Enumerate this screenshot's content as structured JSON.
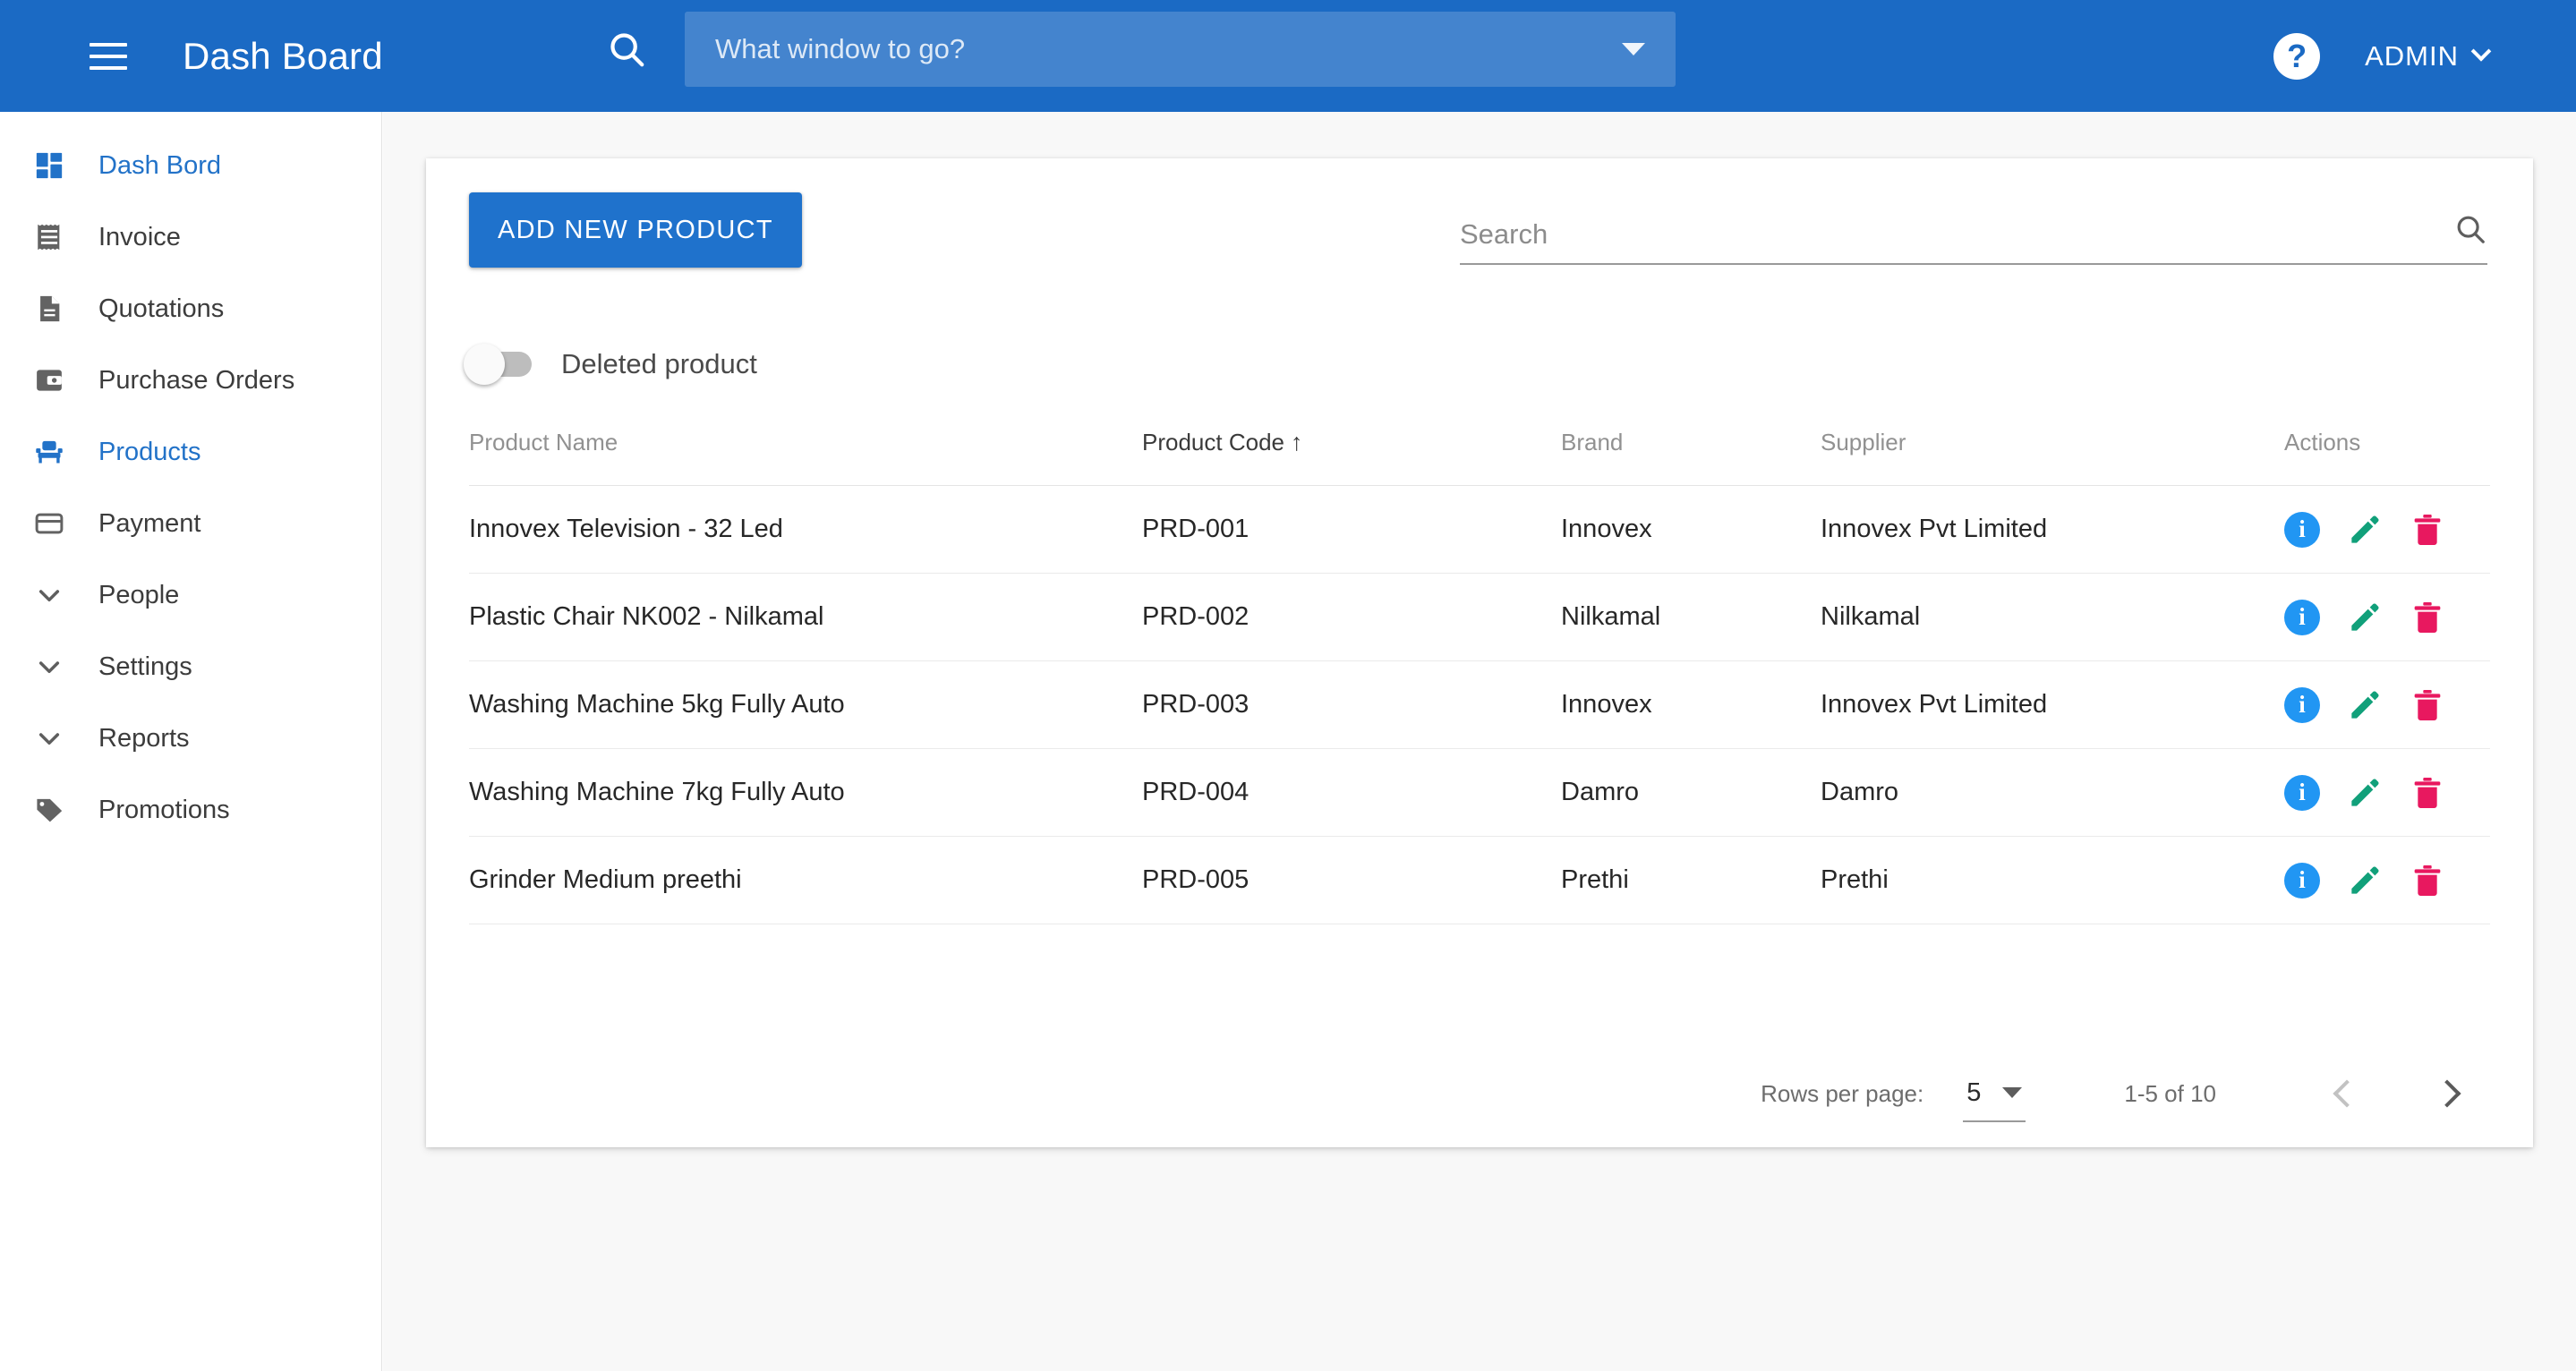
{
  "appbar": {
    "menu_icon": "hamburger-menu-icon",
    "title": "Dash Board",
    "search_icon": "search-icon",
    "search_placeholder": "What window to go?",
    "dropdown_icon": "caret-down-icon",
    "help_icon": "help-question-icon",
    "help_label": "?",
    "admin_label": "ADMIN",
    "admin_chevron": "chevron-down-icon",
    "bg_color": "#1b6ac4"
  },
  "sidebar": {
    "items": [
      {
        "label": "Dash Bord",
        "icon": "dashboard-grid-icon",
        "active": true
      },
      {
        "label": "Invoice",
        "icon": "invoice-receipt-icon",
        "active": false
      },
      {
        "label": "Quotations",
        "icon": "document-icon",
        "active": false
      },
      {
        "label": "Purchase Orders",
        "icon": "wallet-icon",
        "active": false
      },
      {
        "label": "Products",
        "icon": "armchair-icon",
        "active": true
      },
      {
        "label": "Payment",
        "icon": "credit-card-icon",
        "active": false
      },
      {
        "label": "People",
        "icon": "chevron-down-icon",
        "active": false
      },
      {
        "label": "Settings",
        "icon": "chevron-down-icon",
        "active": false
      },
      {
        "label": "Reports",
        "icon": "chevron-down-icon",
        "active": false
      },
      {
        "label": "Promotions",
        "icon": "tag-icon",
        "active": false
      }
    ],
    "active_color": "#2272c8"
  },
  "toolbar": {
    "add_button_label": "ADD NEW PRODUCT",
    "add_button_color": "#1f72cc",
    "search_placeholder": "Search",
    "search_icon": "search-icon"
  },
  "filters": {
    "deleted_toggle_label": "Deleted product",
    "deleted_toggle_on": false
  },
  "table": {
    "columns": [
      {
        "label": "Product Name",
        "sorted": false
      },
      {
        "label": "Product Code",
        "sorted": true,
        "sort_dir": "↑"
      },
      {
        "label": "Brand",
        "sorted": false
      },
      {
        "label": "Supplier",
        "sorted": false
      },
      {
        "label": "Actions",
        "sorted": false
      }
    ],
    "rows": [
      {
        "name": "Innovex Television - 32 Led",
        "code": "PRD-001",
        "brand": "Innovex",
        "supplier": "Innovex Pvt Limited"
      },
      {
        "name": "Plastic Chair NK002 - Nilkamal",
        "code": "PRD-002",
        "brand": "Nilkamal",
        "supplier": "Nilkamal"
      },
      {
        "name": "Washing Machine 5kg Fully Auto",
        "code": "PRD-003",
        "brand": "Innovex",
        "supplier": "Innovex Pvt Limited"
      },
      {
        "name": "Washing Machine 7kg Fully Auto",
        "code": "PRD-004",
        "brand": "Damro",
        "supplier": "Damro"
      },
      {
        "name": "Grinder Medium preethi",
        "code": "PRD-005",
        "brand": "Prethi",
        "supplier": "Prethi"
      }
    ],
    "action_icons": {
      "info": "info-circle-icon",
      "edit": "pencil-edit-icon",
      "delete": "trash-delete-icon",
      "info_color": "#2196f3",
      "edit_color": "#11a07a",
      "delete_color": "#e8185f"
    }
  },
  "pagination": {
    "rows_per_page_label": "Rows per page:",
    "rows_per_page_value": "5",
    "rows_per_page_caret": "caret-down-icon",
    "range_label": "1-5 of 10",
    "prev_icon": "chevron-left-icon",
    "next_icon": "chevron-right-icon"
  }
}
